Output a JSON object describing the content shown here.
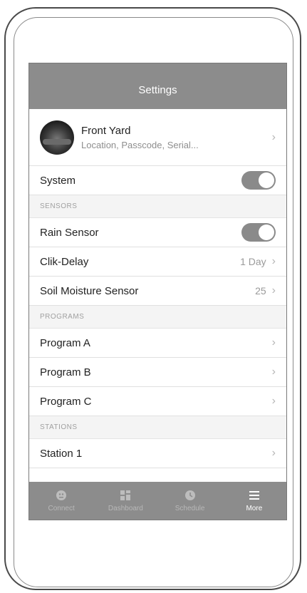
{
  "header": {
    "title": "Settings"
  },
  "profile": {
    "name": "Front Yard",
    "subtitle": "Location, Passcode, Serial..."
  },
  "system": {
    "label": "System",
    "toggle_on": true
  },
  "sensors": {
    "section": "SENSORS",
    "rain_sensor": {
      "label": "Rain Sensor",
      "toggle_on": true
    },
    "clik_delay": {
      "label": "Clik-Delay",
      "value": "1 Day"
    },
    "soil_moisture": {
      "label": "Soil Moisture Sensor",
      "value": "25"
    }
  },
  "programs": {
    "section": "PROGRAMS",
    "items": [
      {
        "label": "Program A"
      },
      {
        "label": "Program B"
      },
      {
        "label": "Program C"
      }
    ]
  },
  "stations": {
    "section": "STATIONS",
    "items": [
      {
        "label": "Station 1"
      }
    ]
  },
  "tabbar": {
    "tabs": [
      {
        "label": "Connect",
        "icon": "connect-icon"
      },
      {
        "label": "Dashboard",
        "icon": "dashboard-icon"
      },
      {
        "label": "Schedule",
        "icon": "clock-icon"
      },
      {
        "label": "More",
        "icon": "menu-icon",
        "active": true
      }
    ]
  },
  "chevron": "›",
  "colors": {
    "header": "#8c8c8c",
    "toggle_on": "#8a8a8a"
  }
}
